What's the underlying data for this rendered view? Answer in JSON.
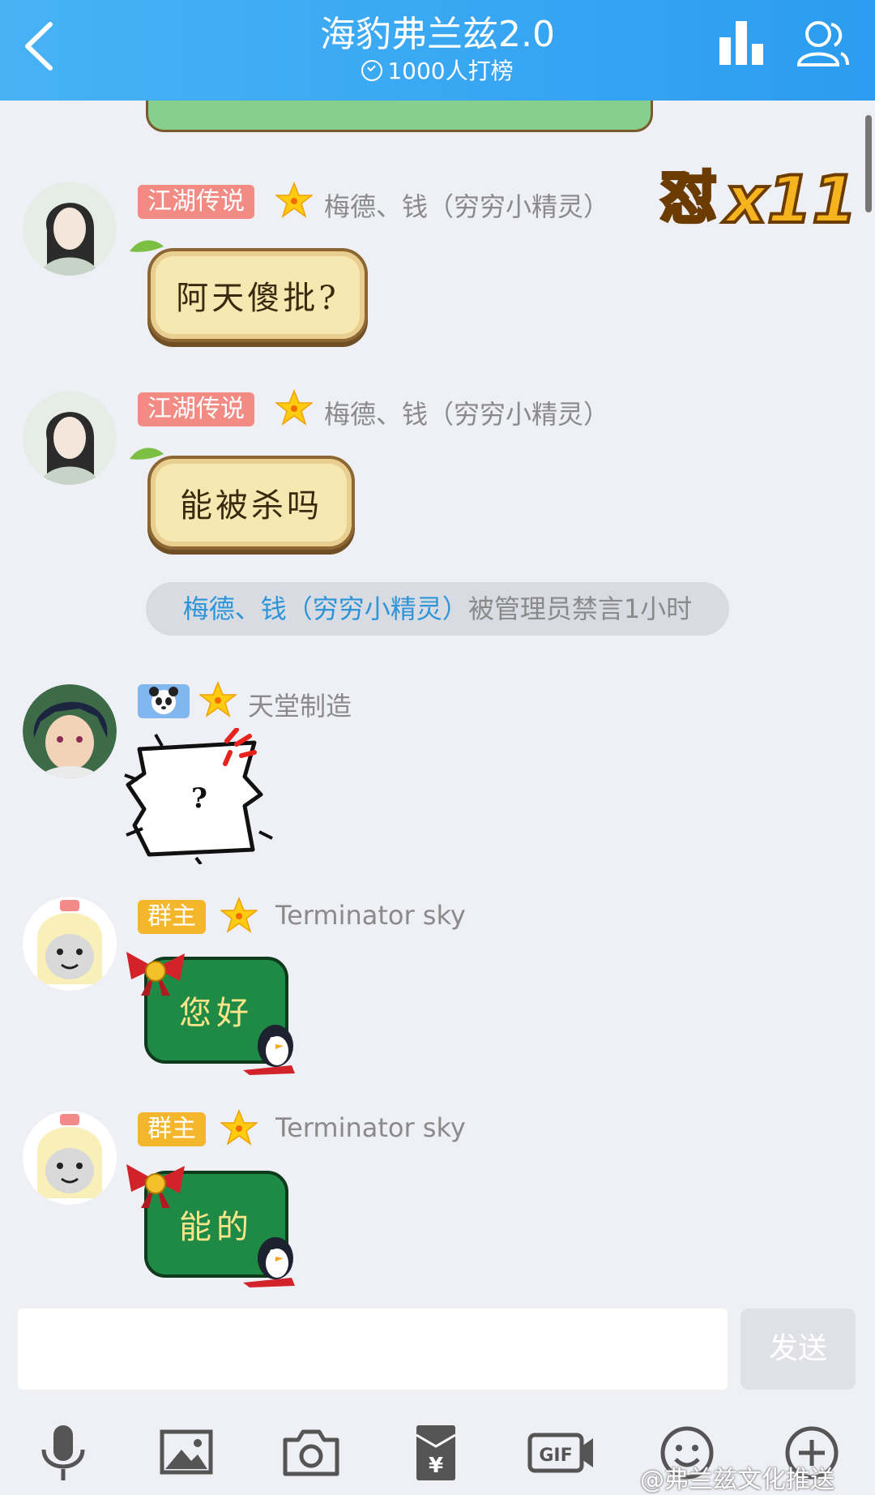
{
  "header": {
    "title": "海豹弗兰兹2.0",
    "subtitle": "1000人打榜",
    "accent": "#2c9cf0"
  },
  "combo": {
    "label": "怼",
    "count": "x11"
  },
  "messages": [
    {
      "badge": "江湖传说",
      "sender": "梅德、钱（穷穷小精灵）",
      "text": "阿天傻批?",
      "bubble": "wood"
    },
    {
      "badge": "江湖传说",
      "sender": "梅德、钱（穷穷小精灵）",
      "text": "能被杀吗",
      "bubble": "wood"
    },
    {
      "badge_icon": "panda-icon",
      "sender": "天堂制造",
      "sticker_text": "?",
      "bubble": "sticker"
    },
    {
      "badge": "群主",
      "sender": "Terminator sky",
      "text": "您好",
      "bubble": "green"
    },
    {
      "badge": "群主",
      "sender": "Terminator sky",
      "text": "能的",
      "bubble": "green"
    }
  ],
  "system": {
    "name": "梅德、钱（穷穷小精灵）",
    "rest": "被管理员禁言1小时"
  },
  "composer": {
    "send_label": "发送",
    "placeholder": ""
  },
  "toolbar_icons": [
    "mic-icon",
    "image-icon",
    "camera-icon",
    "red-packet-icon",
    "gif-icon",
    "emoji-icon",
    "plus-icon"
  ],
  "watermark": "@弗兰兹文化推送"
}
